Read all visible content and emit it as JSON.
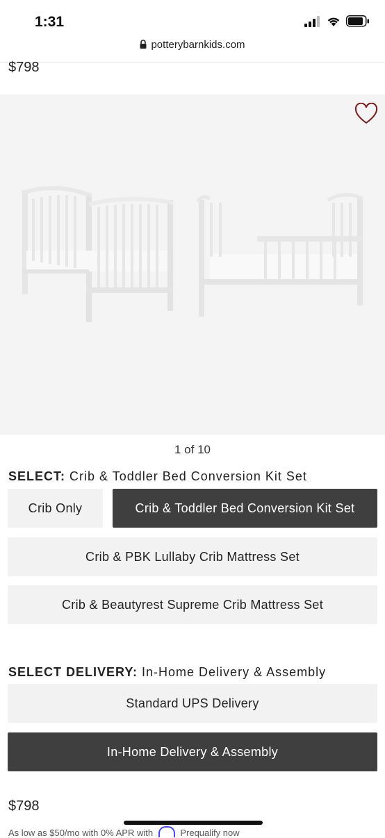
{
  "status_bar": {
    "time": "1:31"
  },
  "url_bar": {
    "domain": "potterybarnkids.com"
  },
  "product": {
    "price_top": "$798",
    "price_bottom": "$798"
  },
  "gallery": {
    "counter": "1 of 10"
  },
  "configuration": {
    "label": "SELECT:",
    "selected_value": "Crib & Toddler Bed Conversion Kit Set",
    "options": [
      "Crib Only",
      "Crib & Toddler Bed Conversion Kit Set",
      "Crib & PBK Lullaby Crib Mattress Set",
      "Crib & Beautyrest Supreme Crib Mattress Set"
    ]
  },
  "delivery": {
    "label": "SELECT DELIVERY:",
    "selected_value": "In-Home Delivery & Assembly",
    "options": [
      "Standard UPS Delivery",
      "In-Home Delivery & Assembly"
    ]
  },
  "financing": {
    "text_left": "As low as $50/mo with 0% APR with",
    "link": "Prequalify now"
  },
  "colors": {
    "selected_bg": "#3f3f3f",
    "option_bg": "#f2f2f2",
    "heart": "#7a1a1a"
  }
}
